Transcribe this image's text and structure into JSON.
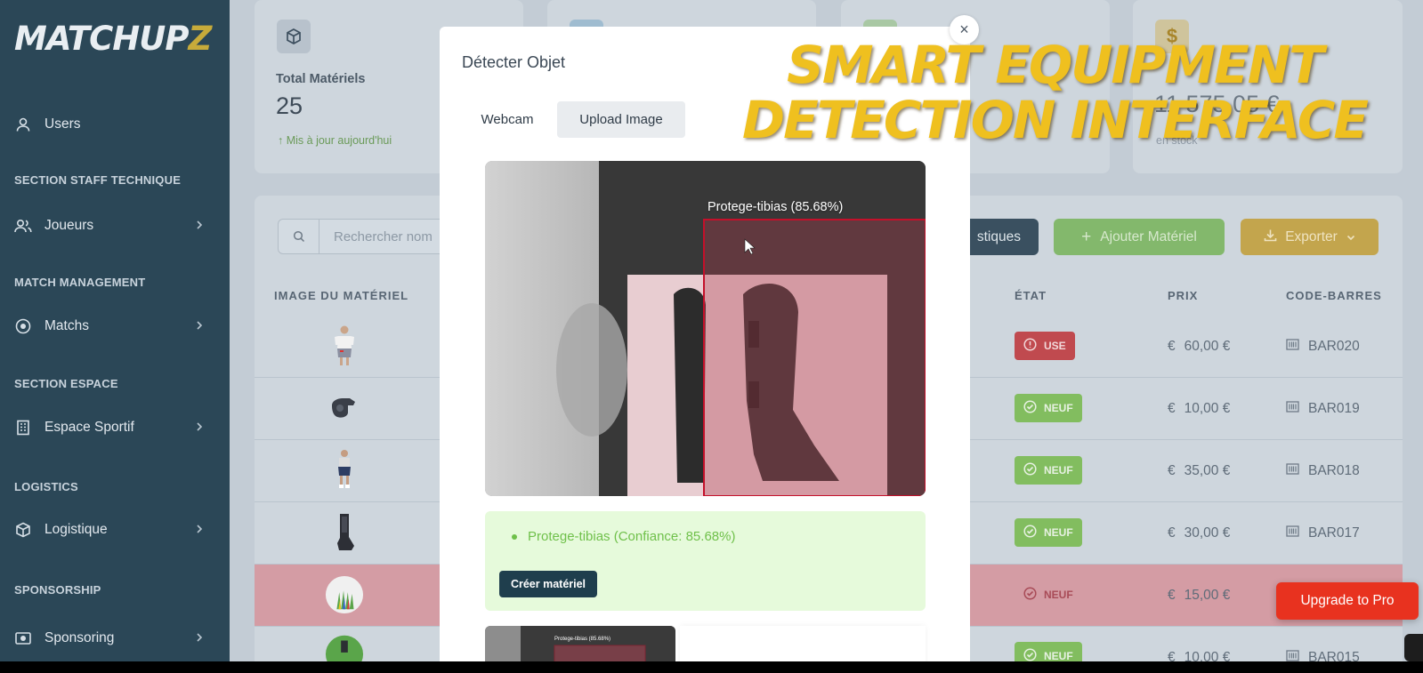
{
  "brand": {
    "logo_main": "MATCHUP",
    "logo_accent": "Z"
  },
  "sidebar": {
    "items": [
      {
        "label": "Users",
        "icon": "user-icon"
      },
      {
        "label": "Joueurs",
        "icon": "users-icon"
      },
      {
        "label": "Matchs",
        "icon": "target-icon"
      },
      {
        "label": "Espace Sportif",
        "icon": "building-icon"
      },
      {
        "label": "Logistique",
        "icon": "box-icon"
      },
      {
        "label": "Sponsoring",
        "icon": "camera-icon"
      }
    ],
    "sections": {
      "staff": "SECTION STAFF TECHNIQUE",
      "match": "MATCH MANAGEMENT",
      "espace": "SECTION ESPACE",
      "logistics": "LOGISTICS",
      "sponsorship": "SPONSORSHIP"
    }
  },
  "stats": {
    "total_label": "Total Matériels",
    "total_value": "25",
    "total_sub": "Mis à jour aujourd'hui",
    "value_partial": "11 575,05 €",
    "value_sub_partial": "en stock"
  },
  "toolbar": {
    "search_placeholder": "Rechercher nom",
    "stats_label": "stiques",
    "add_label": "Ajouter Matériel",
    "export_label": "Exporter"
  },
  "table": {
    "headers": {
      "image": "IMAGE DU MATÉRIEL",
      "etat": "ÉTAT",
      "prix": "PRIX",
      "code": "CODE-BARRES"
    },
    "rows": [
      {
        "etat": "USE",
        "prix": "60,00 €",
        "code": "BAR020"
      },
      {
        "etat": "NEUF",
        "prix": "10,00 €",
        "code": "BAR019"
      },
      {
        "etat": "NEUF",
        "prix": "35,00 €",
        "code": "BAR018"
      },
      {
        "etat": "NEUF",
        "prix": "30,00 €",
        "code": "BAR017"
      },
      {
        "etat": "NEUF",
        "prix": "15,00 €",
        "code": ""
      },
      {
        "etat": "NEUF",
        "prix": "10,00 €",
        "code": "BAR015"
      }
    ]
  },
  "modal": {
    "title": "Détecter Objet",
    "tabs": {
      "webcam": "Webcam",
      "upload": "Upload Image"
    },
    "detection_label": "Protege-tibias (85.68%)",
    "result_text": "Protege-tibias (Confiance: 85.68%)",
    "create_button": "Créer matériel",
    "thumb_label": "Protege-tibias (85.68%)",
    "close_symbol": "×"
  },
  "upgrade_label": "Upgrade to Pro",
  "headline": {
    "line1": "SMART EQUIPMENT",
    "line2": "DETECTION INTERFACE"
  },
  "colors": {
    "sidebar": "#2b4757",
    "accent_gold": "#efc01f",
    "danger": "#e8321f",
    "success": "#6fc04a",
    "primary_dark": "#1f3e4d"
  }
}
